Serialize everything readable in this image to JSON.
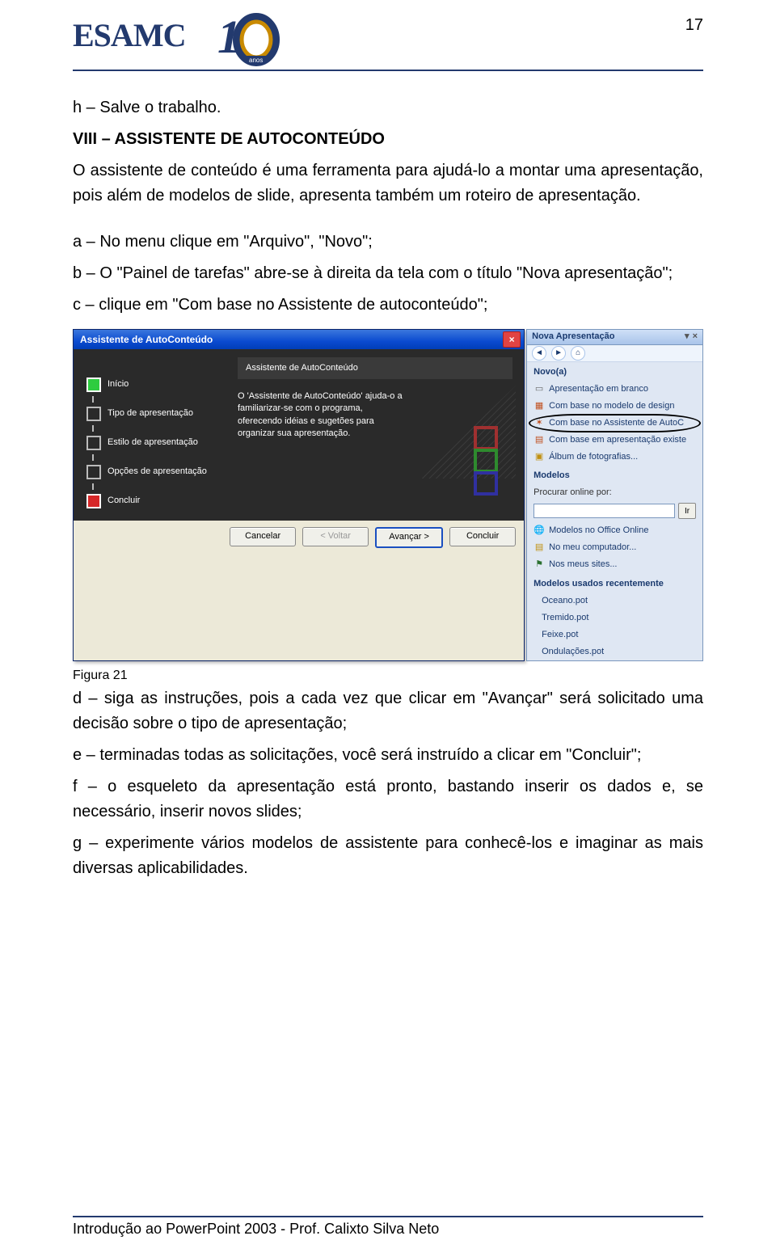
{
  "page_number": "17",
  "logo_text": "ESAMC",
  "logo_badge": "10",
  "logo_badge_sub": "anos",
  "body": {
    "p1": "h – Salve o trabalho.",
    "h2": "VIII – ASSISTENTE DE AUTOCONTEÚDO",
    "p2": "O assistente de conteúdo é uma ferramenta para ajudá-lo a montar uma apresentação, pois além de modelos de slide, apresenta também um roteiro de apresentação.",
    "p3": "a – No menu clique em \"Arquivo\", \"Novo\";",
    "p4": "b – O \"Painel de tarefas\" abre-se à direita da tela com o título \"Nova apresentação\";",
    "p5": "c – clique em \"Com base no Assistente de autoconteúdo\";",
    "fig_caption": "Figura 21",
    "p6": "d – siga as instruções, pois a cada vez que clicar em \"Avançar\" será solicitado uma decisão sobre o tipo de apresentação;",
    "p7": "e – terminadas todas as solicitações, você será instruído a clicar em \"Concluir\";",
    "p8": "f – o esqueleto da apresentação está pronto, bastando inserir os dados e, se necessário, inserir novos slides;",
    "p9": "g – experimente vários modelos de assistente para conhecê-los e imaginar as mais diversas aplicabilidades."
  },
  "wizard": {
    "title": "Assistente de AutoConteúdo",
    "steps": [
      "Início",
      "Tipo de apresentação",
      "Estilo de apresentação",
      "Opções de apresentação",
      "Concluir"
    ],
    "banner": "Assistente de AutoConteúdo",
    "description": "O 'Assistente de AutoConteúdo' ajuda-o a familiarizar-se com o programa, oferecendo idéias e sugetões para organizar sua apresentação.",
    "buttons": {
      "cancel": "Cancelar",
      "back": "< Voltar",
      "next": "Avançar >",
      "finish": "Concluir"
    }
  },
  "taskpane": {
    "header": "Nova Apresentação",
    "novo_header": "Novo(a)",
    "novo_items": [
      {
        "icon": "doc",
        "label": "Apresentação em branco"
      },
      {
        "icon": "grid",
        "label": "Com base no modelo de design"
      },
      {
        "icon": "wiz",
        "label": "Com base no  Assistente de AutoC",
        "circled": true
      },
      {
        "icon": "pres",
        "label": "Com base em apresentação existe"
      },
      {
        "icon": "fold",
        "label": "Álbum de fotografias..."
      }
    ],
    "modelos_header": "Modelos",
    "search_label": "Procurar online por:",
    "search_go": "Ir",
    "model_links": [
      {
        "icon": "globe",
        "label": "Modelos no Office Online"
      },
      {
        "icon": "fold",
        "label": "No meu computador..."
      },
      {
        "icon": "net",
        "label": "Nos meus sites..."
      }
    ],
    "recent_header": "Modelos usados recentemente",
    "recent_items": [
      "Oceano.pot",
      "Tremido.pot",
      "Feixe.pot",
      "Ondulações.pot"
    ]
  },
  "footer": "Introdução ao PowerPoint 2003 - Prof. Calixto Silva Neto"
}
